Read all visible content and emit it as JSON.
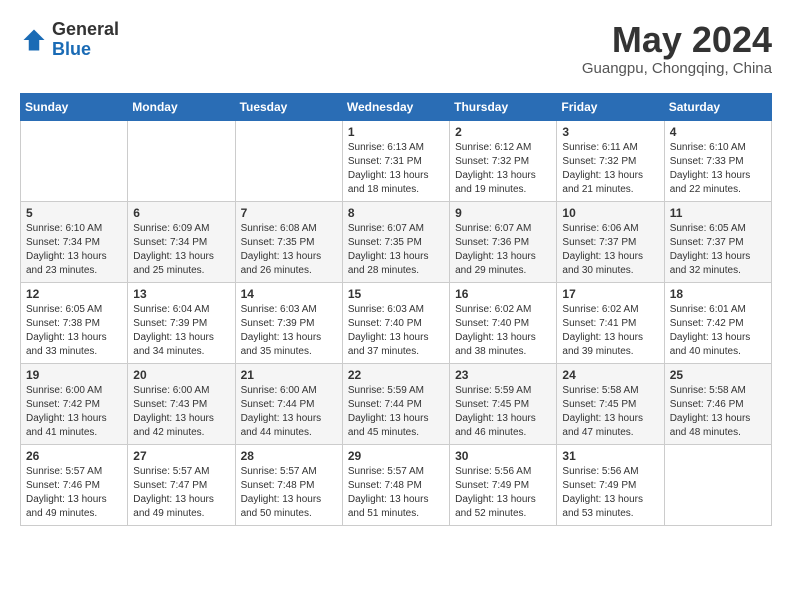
{
  "header": {
    "logo_general": "General",
    "logo_blue": "Blue",
    "month": "May 2024",
    "location": "Guangpu, Chongqing, China"
  },
  "weekdays": [
    "Sunday",
    "Monday",
    "Tuesday",
    "Wednesday",
    "Thursday",
    "Friday",
    "Saturday"
  ],
  "weeks": [
    [
      {
        "day": "",
        "info": ""
      },
      {
        "day": "",
        "info": ""
      },
      {
        "day": "",
        "info": ""
      },
      {
        "day": "1",
        "info": "Sunrise: 6:13 AM\nSunset: 7:31 PM\nDaylight: 13 hours and 18 minutes."
      },
      {
        "day": "2",
        "info": "Sunrise: 6:12 AM\nSunset: 7:32 PM\nDaylight: 13 hours and 19 minutes."
      },
      {
        "day": "3",
        "info": "Sunrise: 6:11 AM\nSunset: 7:32 PM\nDaylight: 13 hours and 21 minutes."
      },
      {
        "day": "4",
        "info": "Sunrise: 6:10 AM\nSunset: 7:33 PM\nDaylight: 13 hours and 22 minutes."
      }
    ],
    [
      {
        "day": "5",
        "info": "Sunrise: 6:10 AM\nSunset: 7:34 PM\nDaylight: 13 hours and 23 minutes."
      },
      {
        "day": "6",
        "info": "Sunrise: 6:09 AM\nSunset: 7:34 PM\nDaylight: 13 hours and 25 minutes."
      },
      {
        "day": "7",
        "info": "Sunrise: 6:08 AM\nSunset: 7:35 PM\nDaylight: 13 hours and 26 minutes."
      },
      {
        "day": "8",
        "info": "Sunrise: 6:07 AM\nSunset: 7:35 PM\nDaylight: 13 hours and 28 minutes."
      },
      {
        "day": "9",
        "info": "Sunrise: 6:07 AM\nSunset: 7:36 PM\nDaylight: 13 hours and 29 minutes."
      },
      {
        "day": "10",
        "info": "Sunrise: 6:06 AM\nSunset: 7:37 PM\nDaylight: 13 hours and 30 minutes."
      },
      {
        "day": "11",
        "info": "Sunrise: 6:05 AM\nSunset: 7:37 PM\nDaylight: 13 hours and 32 minutes."
      }
    ],
    [
      {
        "day": "12",
        "info": "Sunrise: 6:05 AM\nSunset: 7:38 PM\nDaylight: 13 hours and 33 minutes."
      },
      {
        "day": "13",
        "info": "Sunrise: 6:04 AM\nSunset: 7:39 PM\nDaylight: 13 hours and 34 minutes."
      },
      {
        "day": "14",
        "info": "Sunrise: 6:03 AM\nSunset: 7:39 PM\nDaylight: 13 hours and 35 minutes."
      },
      {
        "day": "15",
        "info": "Sunrise: 6:03 AM\nSunset: 7:40 PM\nDaylight: 13 hours and 37 minutes."
      },
      {
        "day": "16",
        "info": "Sunrise: 6:02 AM\nSunset: 7:40 PM\nDaylight: 13 hours and 38 minutes."
      },
      {
        "day": "17",
        "info": "Sunrise: 6:02 AM\nSunset: 7:41 PM\nDaylight: 13 hours and 39 minutes."
      },
      {
        "day": "18",
        "info": "Sunrise: 6:01 AM\nSunset: 7:42 PM\nDaylight: 13 hours and 40 minutes."
      }
    ],
    [
      {
        "day": "19",
        "info": "Sunrise: 6:00 AM\nSunset: 7:42 PM\nDaylight: 13 hours and 41 minutes."
      },
      {
        "day": "20",
        "info": "Sunrise: 6:00 AM\nSunset: 7:43 PM\nDaylight: 13 hours and 42 minutes."
      },
      {
        "day": "21",
        "info": "Sunrise: 6:00 AM\nSunset: 7:44 PM\nDaylight: 13 hours and 44 minutes."
      },
      {
        "day": "22",
        "info": "Sunrise: 5:59 AM\nSunset: 7:44 PM\nDaylight: 13 hours and 45 minutes."
      },
      {
        "day": "23",
        "info": "Sunrise: 5:59 AM\nSunset: 7:45 PM\nDaylight: 13 hours and 46 minutes."
      },
      {
        "day": "24",
        "info": "Sunrise: 5:58 AM\nSunset: 7:45 PM\nDaylight: 13 hours and 47 minutes."
      },
      {
        "day": "25",
        "info": "Sunrise: 5:58 AM\nSunset: 7:46 PM\nDaylight: 13 hours and 48 minutes."
      }
    ],
    [
      {
        "day": "26",
        "info": "Sunrise: 5:57 AM\nSunset: 7:46 PM\nDaylight: 13 hours and 49 minutes."
      },
      {
        "day": "27",
        "info": "Sunrise: 5:57 AM\nSunset: 7:47 PM\nDaylight: 13 hours and 49 minutes."
      },
      {
        "day": "28",
        "info": "Sunrise: 5:57 AM\nSunset: 7:48 PM\nDaylight: 13 hours and 50 minutes."
      },
      {
        "day": "29",
        "info": "Sunrise: 5:57 AM\nSunset: 7:48 PM\nDaylight: 13 hours and 51 minutes."
      },
      {
        "day": "30",
        "info": "Sunrise: 5:56 AM\nSunset: 7:49 PM\nDaylight: 13 hours and 52 minutes."
      },
      {
        "day": "31",
        "info": "Sunrise: 5:56 AM\nSunset: 7:49 PM\nDaylight: 13 hours and 53 minutes."
      },
      {
        "day": "",
        "info": ""
      }
    ]
  ]
}
